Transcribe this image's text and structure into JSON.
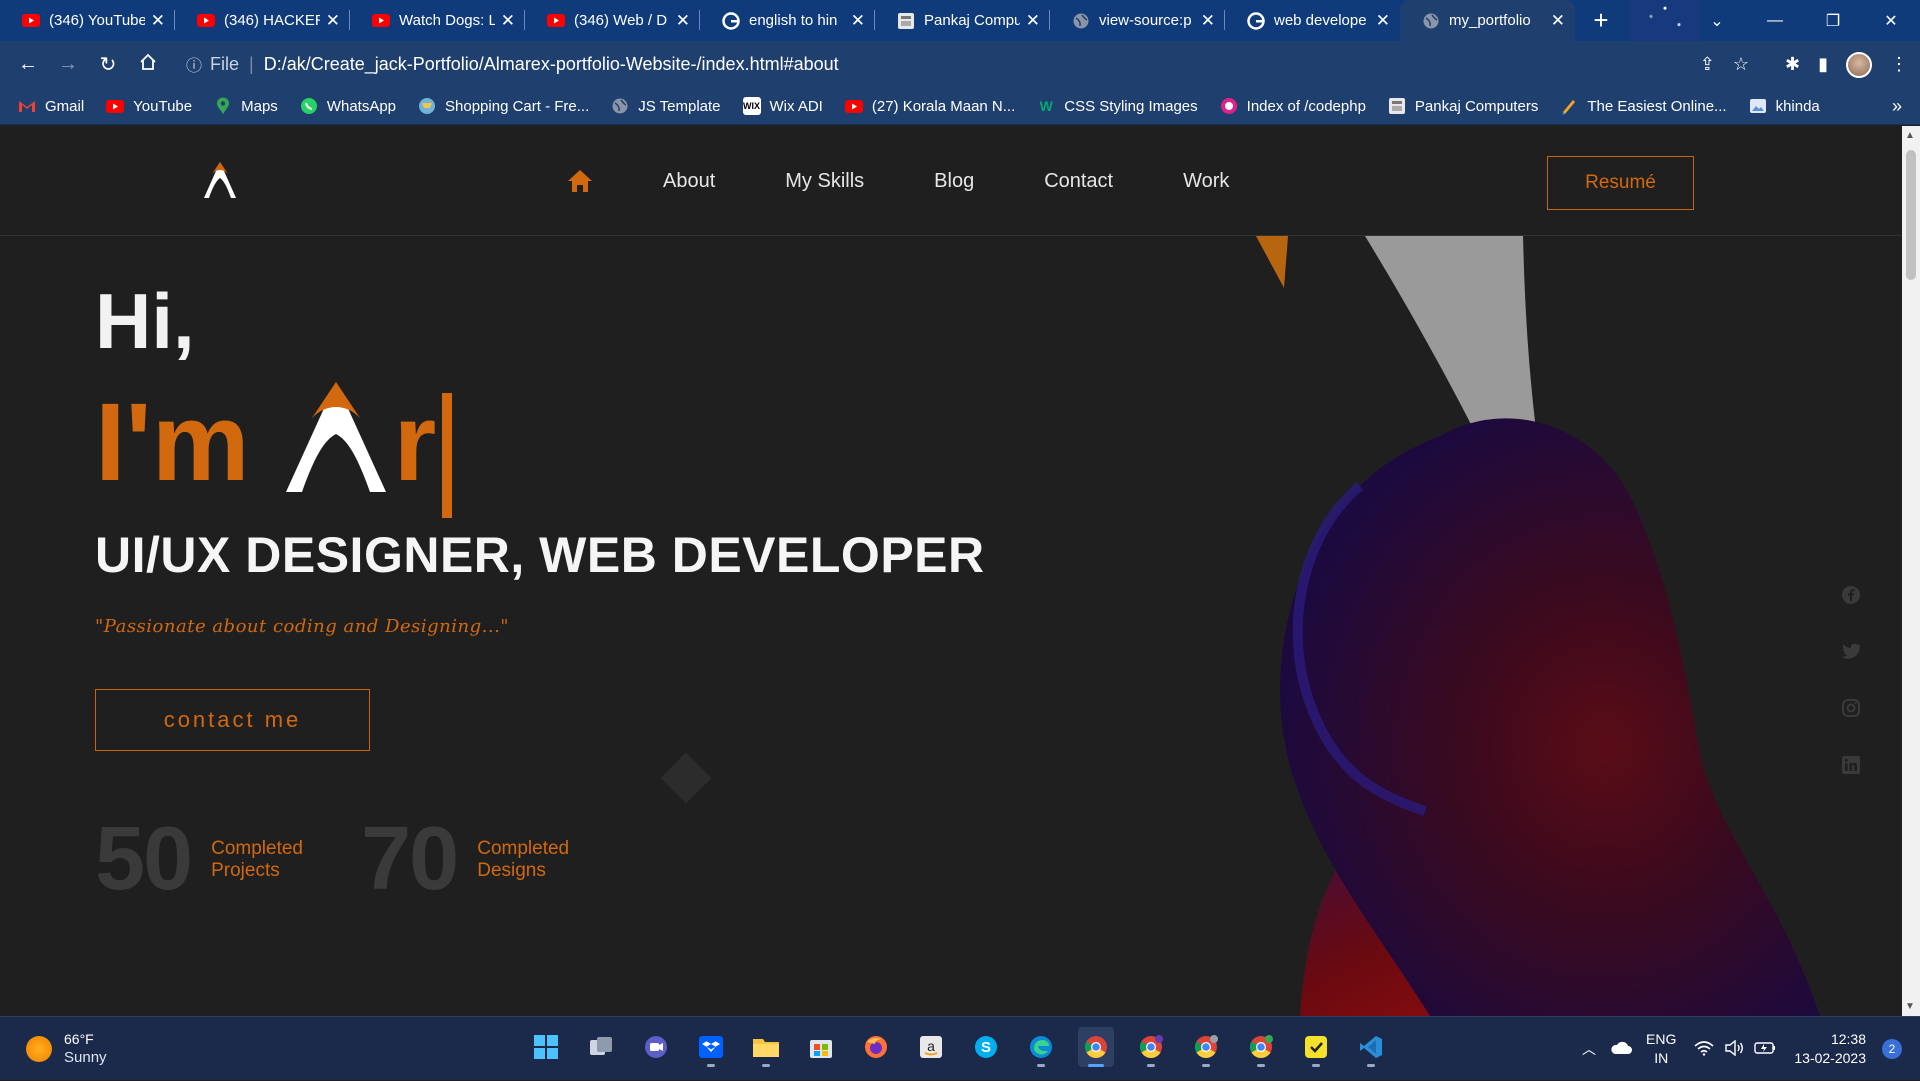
{
  "browser": {
    "tabs": [
      {
        "title": "(346) YouTube",
        "icon": "youtube-icon"
      },
      {
        "title": "(346) HACKER",
        "icon": "youtube-icon"
      },
      {
        "title": "Watch Dogs: L",
        "icon": "youtube-icon"
      },
      {
        "title": "(346) Web / D",
        "icon": "youtube-icon"
      },
      {
        "title": "english to hin",
        "icon": "google-icon"
      },
      {
        "title": "Pankaj Compu",
        "icon": "site-icon"
      },
      {
        "title": "view-source:p",
        "icon": "globe-icon"
      },
      {
        "title": "web develope",
        "icon": "google-icon"
      },
      {
        "title": "my_portfolio",
        "icon": "globe-icon",
        "active": true
      }
    ],
    "address": {
      "scheme": "File",
      "url": "D:/ak/Create_jack-Portfolio/Almarex-portfolio-Website-/index.html#about"
    },
    "bookmarks": [
      {
        "label": "Gmail",
        "icon": "gmail-icon"
      },
      {
        "label": "YouTube",
        "icon": "youtube-icon"
      },
      {
        "label": "Maps",
        "icon": "maps-icon"
      },
      {
        "label": "WhatsApp",
        "icon": "whatsapp-icon"
      },
      {
        "label": "Shopping Cart - Fre...",
        "icon": "cart-icon"
      },
      {
        "label": "JS Template",
        "icon": "globe-icon"
      },
      {
        "label": "Wix ADI",
        "icon": "wix-icon"
      },
      {
        "label": "(27) Korala Maan N...",
        "icon": "youtube-icon"
      },
      {
        "label": "CSS Styling Images",
        "icon": "w3-icon"
      },
      {
        "label": "Index of /codephp",
        "icon": "site-icon"
      },
      {
        "label": "Pankaj Computers",
        "icon": "site-icon"
      },
      {
        "label": "The Easiest Online...",
        "icon": "pen-icon"
      },
      {
        "label": "khinda",
        "icon": "image-icon"
      }
    ]
  },
  "site": {
    "nav": {
      "items": [
        "About",
        "My Skills",
        "Blog",
        "Contact",
        "Work"
      ],
      "resume": "Resumé"
    },
    "hero": {
      "greeting": "Hi,",
      "im": "I'm",
      "typed": "r",
      "role": "UI/UX DESIGNER, WEB DEVELOPER",
      "tagline": "\"Passionate about coding and Designing...\"",
      "contact_button": "contact me"
    },
    "stats": [
      {
        "number": "50",
        "label": "Completed Projects"
      },
      {
        "number": "70",
        "label": "Completed Designs"
      }
    ],
    "social": [
      "facebook-icon",
      "twitter-icon",
      "instagram-icon",
      "linkedin-icon"
    ]
  },
  "taskbar": {
    "weather": {
      "temp": "66°F",
      "condition": "Sunny"
    },
    "language": {
      "line1": "ENG",
      "line2": "IN"
    },
    "clock": {
      "time": "12:38",
      "date": "13-02-2023"
    },
    "notifications": "2"
  },
  "colors": {
    "accent": "#d2690e",
    "page_bg": "#1f1f1f",
    "browser_chrome": "#1f3f6e",
    "tab_strip": "#0f3b7a"
  }
}
